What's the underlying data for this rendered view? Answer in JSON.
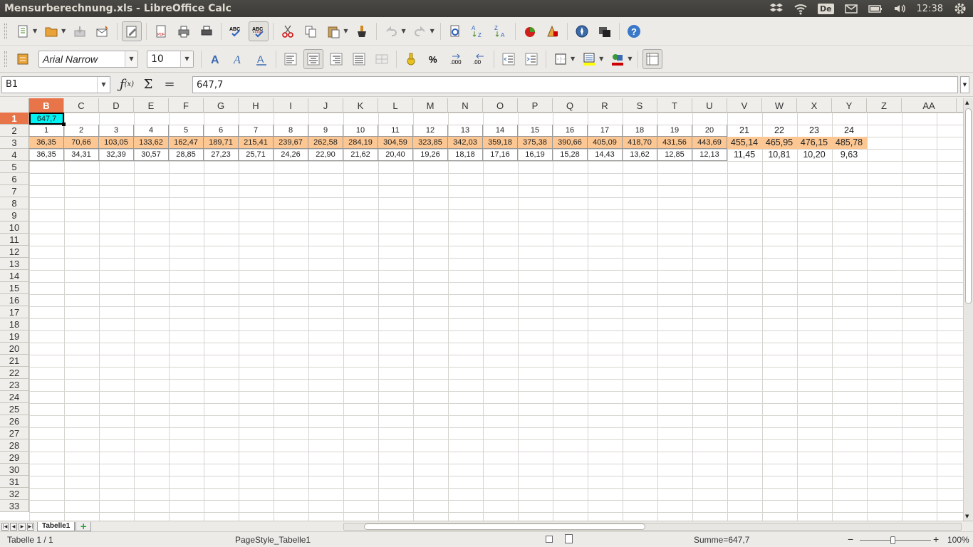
{
  "window": {
    "title": "Mensurberechnung.xls - LibreOffice Calc",
    "keyboard_layout": "De",
    "clock": "12:38"
  },
  "toolbar2": {
    "font_name": "Arial Narrow",
    "font_size": "10"
  },
  "formula_bar": {
    "cell_ref": "B1",
    "content": "647,7"
  },
  "columns": [
    "B",
    "C",
    "D",
    "E",
    "F",
    "G",
    "H",
    "I",
    "J",
    "K",
    "L",
    "M",
    "N",
    "O",
    "P",
    "Q",
    "R",
    "S",
    "T",
    "U",
    "V",
    "W",
    "X",
    "Y",
    "Z",
    "AA"
  ],
  "selected_column": "B",
  "rows": [
    "1",
    "2",
    "3",
    "4",
    "5",
    "6",
    "7",
    "8",
    "9",
    "10",
    "11",
    "12",
    "13",
    "14",
    "15",
    "16",
    "17",
    "18",
    "19",
    "20",
    "21",
    "22",
    "23",
    "24",
    "25",
    "26",
    "27",
    "28",
    "29",
    "30",
    "31",
    "32",
    "33"
  ],
  "selected_row": "1",
  "sheet": {
    "b1_value": "647,7",
    "row2": [
      "1",
      "2",
      "3",
      "4",
      "5",
      "6",
      "7",
      "8",
      "9",
      "10",
      "11",
      "12",
      "13",
      "14",
      "15",
      "16",
      "17",
      "18",
      "19",
      "20",
      "21",
      "22",
      "23",
      "24"
    ],
    "row3": [
      "36,35",
      "70,66",
      "103,05",
      "133,62",
      "162,47",
      "189,71",
      "215,41",
      "239,67",
      "262,58",
      "284,19",
      "304,59",
      "323,85",
      "342,03",
      "359,18",
      "375,38",
      "390,66",
      "405,09",
      "418,70",
      "431,56",
      "443,69",
      "455,14",
      "465,95",
      "476,15",
      "485,78"
    ],
    "row4": [
      "36,35",
      "34,31",
      "32,39",
      "30,57",
      "28,85",
      "27,23",
      "25,71",
      "24,26",
      "22,90",
      "21,62",
      "20,40",
      "19,26",
      "18,18",
      "17,16",
      "16,19",
      "15,28",
      "14,43",
      "13,62",
      "12,85",
      "12,13",
      "11,45",
      "10,81",
      "10,20",
      "9,63"
    ],
    "highlight_color": "#fcc793",
    "active_cell_color": "#00f2f2"
  },
  "tabs": {
    "sheet_name": "Tabelle1"
  },
  "status": {
    "sheet_info": "Tabelle 1 / 1",
    "page_style": "PageStyle_Tabelle1",
    "sum": "Summe=647,7",
    "zoom": "100%"
  }
}
